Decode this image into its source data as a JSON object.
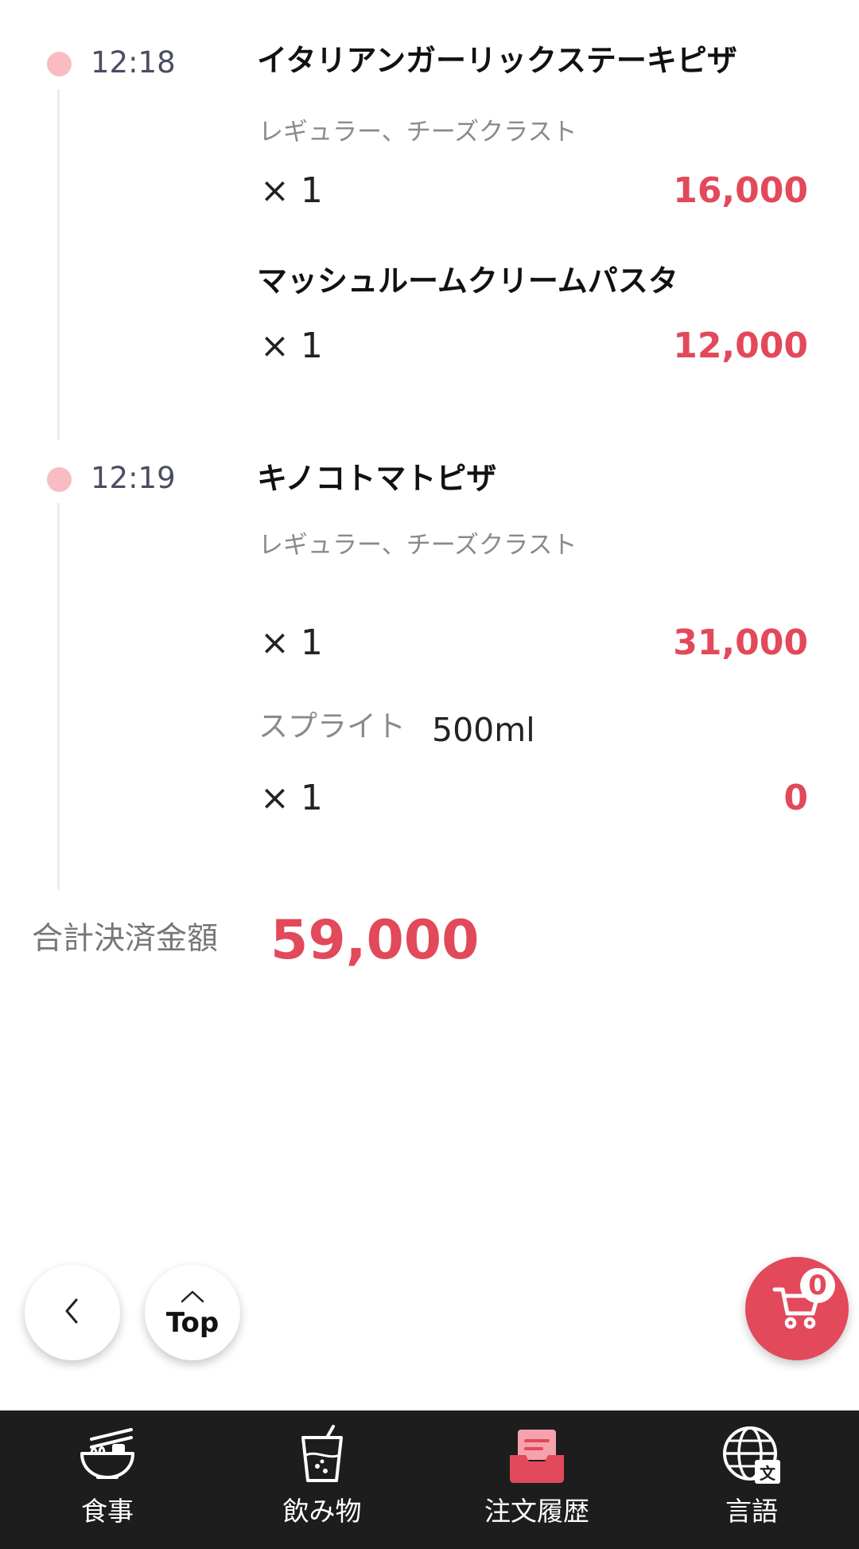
{
  "orders": [
    {
      "time": "12:18",
      "items": [
        {
          "name": "イタリアンガーリックステーキピザ",
          "options": "レギュラー、チーズクラスト",
          "quantity": "× 1",
          "price": "16,000"
        },
        {
          "name": "マッシュルームクリームパスタ",
          "quantity": "× 1",
          "price": "12,000"
        }
      ]
    },
    {
      "time": "12:19",
      "items": [
        {
          "name": "キノコトマトピザ",
          "options": "レギュラー、チーズクラスト",
          "quantity": "× 1",
          "price": "31,000"
        },
        {
          "name": "スプライト",
          "size": "500ml",
          "quantity": "× 1",
          "price": "0"
        }
      ]
    }
  ],
  "total": {
    "label": "合計決済金額",
    "value": "59,000"
  },
  "floating": {
    "top_label": "Top",
    "cart_count": "0"
  },
  "bottom_nav": [
    {
      "label": "食事",
      "icon": "ramen-bowl-icon"
    },
    {
      "label": "飲み物",
      "icon": "drink-cup-icon"
    },
    {
      "label": "注文履歴",
      "icon": "order-history-tray-icon",
      "active": true
    },
    {
      "label": "言語",
      "icon": "globe-language-icon"
    }
  ],
  "colors": {
    "accent": "#e2495a",
    "timeline_dot": "#f9bcc2",
    "nav_background": "#1d1d1d"
  }
}
